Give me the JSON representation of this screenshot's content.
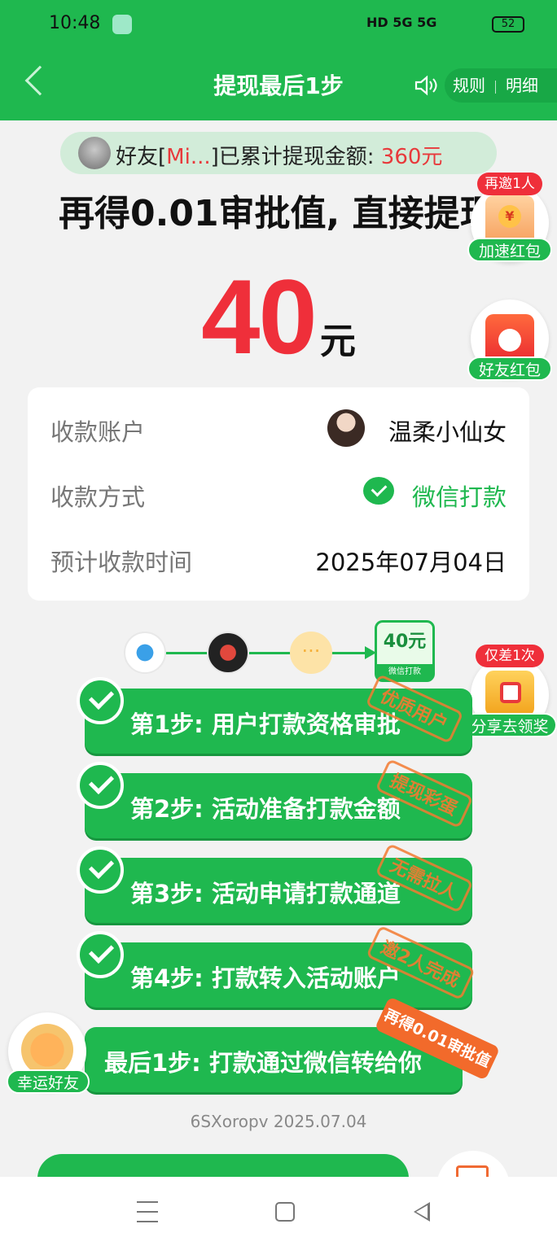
{
  "status_bar": {
    "time": "10:48",
    "network": "HD  5G 5G",
    "battery": "52"
  },
  "header": {
    "title": "提现最后1步",
    "rules": "规则",
    "details": "明细"
  },
  "friend_banner": {
    "prefix": "好友[",
    "name": "Mi...",
    "middle": "]已累计提现金额:",
    "amount": "360元"
  },
  "headline": "再得0.01审批值, 直接提现",
  "amount": {
    "value": "40",
    "unit": "元"
  },
  "side_widgets": {
    "invite_badge": "再邀1人",
    "invite_label": "加速红包",
    "friend_label": "好友红包",
    "share_badge": "仅差1次",
    "share_label": "分享去领奖",
    "coin_symbol": "¥"
  },
  "account_card": {
    "rows": [
      {
        "label": "收款账户",
        "value": "温柔小仙女"
      },
      {
        "label": "收款方式",
        "value": "微信打款"
      },
      {
        "label": "预计收款时间",
        "value": "2025年07月04日"
      }
    ]
  },
  "flow": {
    "ellipsis": "···",
    "money_label": "40元",
    "money_foot": "微信打款"
  },
  "steps": [
    {
      "label": "第1步: 用户打款资格审批",
      "stamp": "优质用户"
    },
    {
      "label": "第2步: 活动准备打款金额",
      "stamp": "提现彩蛋"
    },
    {
      "label": "第3步: 活动申请打款通道",
      "stamp": "无需拉人"
    },
    {
      "label": "第4步: 打款转入活动账户",
      "stamp": "邀2人完成"
    }
  ],
  "last_step": {
    "label": "最后1步: 打款通过微信转给你",
    "badge": "再得0.01审批值"
  },
  "lucky_friend": "幸运好友",
  "footer_code": "6SXoropv 2025.07.04",
  "colors": {
    "brand_green": "#1fb84f",
    "amount_red": "#ef2f3a",
    "stamp_orange": "#f37a30"
  }
}
